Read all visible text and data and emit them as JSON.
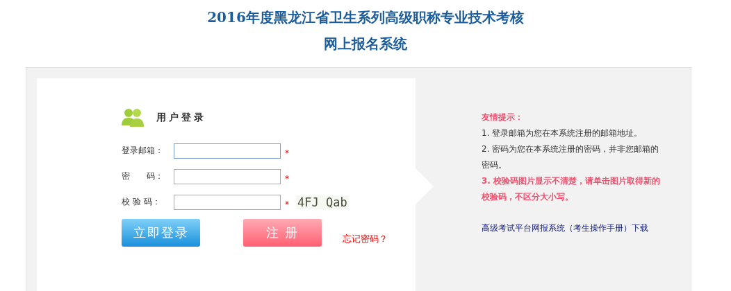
{
  "header": {
    "title_lines": [
      "2016年度黑龙江省卫生系列高级职称专业技术考核",
      "网上报名系统"
    ]
  },
  "login": {
    "heading": "用户登录",
    "fields": [
      {
        "label": "登录邮箱：",
        "required_mark": "*",
        "focused": true,
        "kind": "text"
      },
      {
        "label": "密　　码：",
        "required_mark": "*",
        "focused": false,
        "kind": "password"
      },
      {
        "label": "校 验 码：",
        "required_mark": "*",
        "focused": false,
        "kind": "captcha",
        "captcha": "4FJ Qab"
      }
    ],
    "login_button": "立即登录",
    "register_button": "注 册",
    "forgot_link": "忘记密码？"
  },
  "tips": {
    "heading": "友情提示：",
    "items": [
      {
        "kind": "plain",
        "text": "1.  登录邮箱为您在本系统注册的邮箱地址。"
      },
      {
        "kind": "plain",
        "text": "2.  密码为您在本系统注册的密码，并非您邮箱的密码。"
      },
      {
        "kind": "highlight",
        "text": "3. 校验码图片显示不清楚，请单击图片取得新的校验码，不区分大小写。"
      }
    ],
    "download_link": "高级考试平台网报系统（考生操作手册）下载"
  }
}
